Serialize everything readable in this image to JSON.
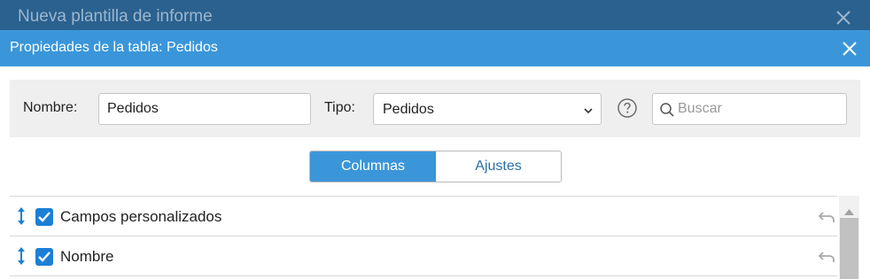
{
  "background_window": {
    "title": "Nueva plantilla de informe",
    "close_icon": "close-icon"
  },
  "dialog": {
    "title": "Propiedades de la tabla: Pedidos",
    "close_icon": "close-icon"
  },
  "properties": {
    "name_label": "Nombre:",
    "name_value": "Pedidos",
    "type_label": "Tipo:",
    "type_value": "Pedidos",
    "help_icon": "question-circle-icon",
    "search_placeholder": "Buscar"
  },
  "tabs": [
    {
      "label": "Columnas",
      "active": true
    },
    {
      "label": "Ajustes",
      "active": false
    }
  ],
  "columns": [
    {
      "label": "Campos personalizados",
      "checked": true
    },
    {
      "label": "Nombre",
      "checked": true
    }
  ],
  "colors": {
    "background_bar": "#2a618f",
    "dialog_header": "#3a96d9",
    "accent": "#3a96d9",
    "checkbox": "#1c7fd6"
  }
}
